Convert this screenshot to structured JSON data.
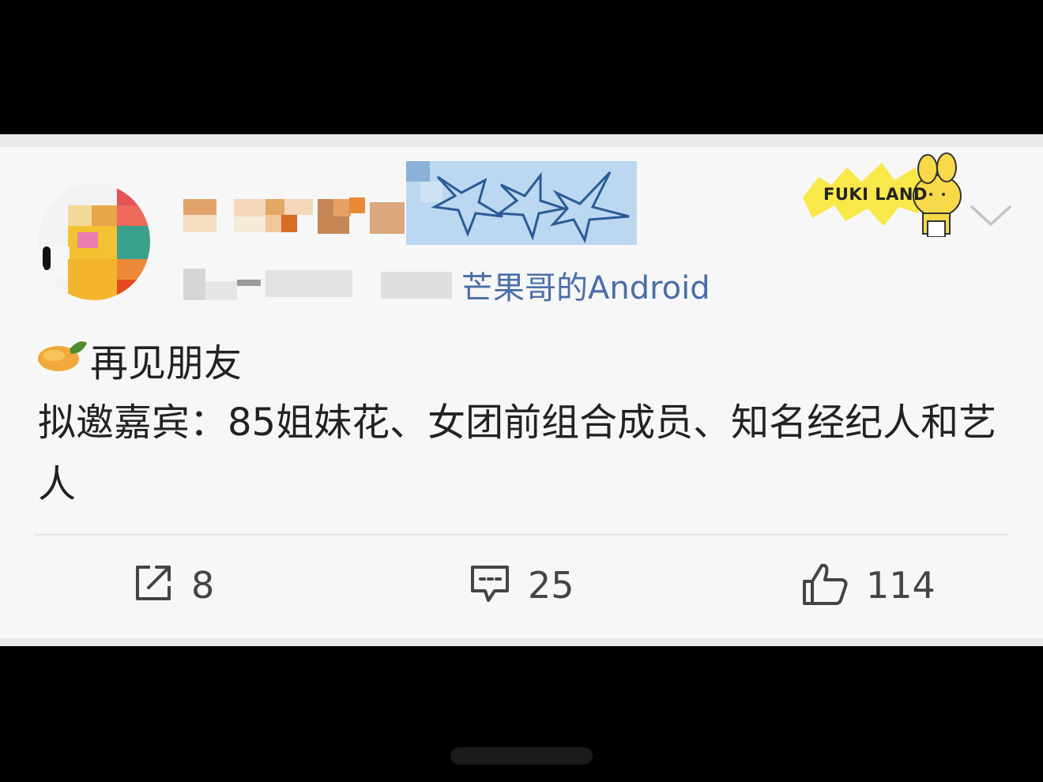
{
  "post": {
    "source": "芒果哥的Android",
    "title": "再见朋友",
    "body": "拟邀嘉宾：85姐妹花、女团前组合成员、知名经纪人和艺人",
    "badge_text": "FUKI LAND"
  },
  "actions": {
    "repost_count": "8",
    "comment_count": "25",
    "like_count": "114"
  },
  "icons": {
    "repost": "share-icon",
    "comment": "comment-icon",
    "like": "thumbs-up-icon",
    "emoji": "mango-icon",
    "more": "chevron-down-icon"
  },
  "colors": {
    "background": "#f7f7f7",
    "source_link": "#4a6ea8",
    "text": "#222222",
    "icon": "#444444"
  }
}
